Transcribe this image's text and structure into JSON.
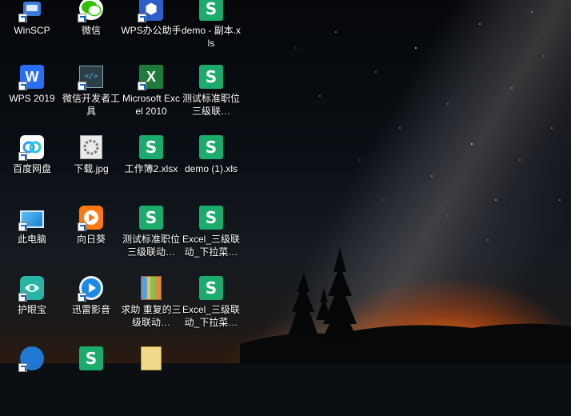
{
  "desktop": {
    "icons": [
      {
        "label": "WinSCP",
        "icon": "winscp-icon"
      },
      {
        "label": "微信",
        "icon": "wechat-icon"
      },
      {
        "label": "WPS办公助手",
        "icon": "wps-assistant-icon"
      },
      {
        "label": "demo - 副本.xls",
        "icon": "wps-spreadsheet-icon"
      },
      {
        "label": "WPS 2019",
        "icon": "wps-2019-icon"
      },
      {
        "label": "微信开发者工具",
        "icon": "wechat-devtools-icon"
      },
      {
        "label": "Microsoft Excel 2010",
        "icon": "excel-2010-icon"
      },
      {
        "label": "测试标准职位三级联…",
        "icon": "wps-spreadsheet-icon"
      },
      {
        "label": "百度网盘",
        "icon": "baidu-netdisk-icon"
      },
      {
        "label": "下载.jpg",
        "icon": "jpg-file-icon"
      },
      {
        "label": "工作簿2.xlsx",
        "icon": "wps-spreadsheet-icon"
      },
      {
        "label": "demo (1).xls",
        "icon": "wps-spreadsheet-icon"
      },
      {
        "label": "此电脑",
        "icon": "this-pc-icon"
      },
      {
        "label": "向日葵",
        "icon": "sunflower-icon"
      },
      {
        "label": "测试标准职位三级联动…",
        "icon": "wps-spreadsheet-icon"
      },
      {
        "label": "Excel_三级联动_下拉菜…",
        "icon": "wps-spreadsheet-icon"
      },
      {
        "label": "护眼宝",
        "icon": "eye-care-icon"
      },
      {
        "label": "迅雷影音",
        "icon": "xunlei-player-icon"
      },
      {
        "label": "求助 重复的三级联动…",
        "icon": "archive-icon"
      },
      {
        "label": "Excel_三级联动_下拉菜…",
        "icon": "wps-spreadsheet-icon"
      },
      {
        "label": "",
        "icon": "blue-app-icon"
      },
      {
        "label": "",
        "icon": "wps-spreadsheet-icon"
      },
      {
        "label": "",
        "icon": "wps-document-icon"
      }
    ]
  },
  "colors": {
    "wps_green": "#1aab6d",
    "wps_blue": "#2a6ff3",
    "excel_green": "#1e7b3c",
    "sunset_orange": "#ff7a12"
  }
}
